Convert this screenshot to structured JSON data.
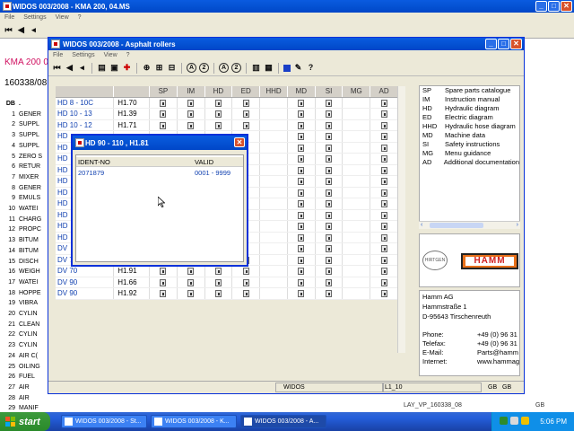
{
  "bg_window": {
    "title": "WIDOS 003/2008 - KMA 200, 04.MS",
    "menu": [
      "File",
      "Settings",
      "View",
      "?"
    ],
    "kma_text": "KMA 200 0",
    "ident_text": "160338/08",
    "table_header": [
      "DB",
      "."
    ],
    "rows": [
      {
        "n": "1",
        "t": "GENER"
      },
      {
        "n": "2",
        "t": "SUPPL"
      },
      {
        "n": "3",
        "t": "SUPPL"
      },
      {
        "n": "4",
        "t": "SUPPL"
      },
      {
        "n": "5",
        "t": "ZERO S"
      },
      {
        "n": "6",
        "t": "RETUR"
      },
      {
        "n": "7",
        "t": "MIXER"
      },
      {
        "n": "8",
        "t": "GENER"
      },
      {
        "n": "9",
        "t": "EMULS"
      },
      {
        "n": "10",
        "t": "WATEI"
      },
      {
        "n": "11",
        "t": "CHARG"
      },
      {
        "n": "12",
        "t": "PROPC"
      },
      {
        "n": "13",
        "t": "BITUM"
      },
      {
        "n": "14",
        "t": "BITUM"
      },
      {
        "n": "15",
        "t": "DISCH"
      },
      {
        "n": "16",
        "t": "WEIGH"
      },
      {
        "n": "17",
        "t": "WATEI"
      },
      {
        "n": "18",
        "t": "HOPPE"
      },
      {
        "n": "19",
        "t": "VIBRA"
      },
      {
        "n": "20",
        "t": "CYLIN"
      },
      {
        "n": "21",
        "t": "CLEAN"
      },
      {
        "n": "22",
        "t": "CYLIN"
      },
      {
        "n": "23",
        "t": "CYLIN"
      },
      {
        "n": "24",
        "t": "AIR C("
      },
      {
        "n": "25",
        "t": "OILING"
      },
      {
        "n": "26",
        "t": "FUEL"
      },
      {
        "n": "27",
        "t": "AIR"
      },
      {
        "n": "28",
        "t": "AIR"
      },
      {
        "n": "29",
        "t": "MANIF"
      }
    ],
    "status_right": "LAY_VP_160338_08",
    "status_gb": "GB"
  },
  "ar_window": {
    "title": "WIDOS 003/2008 - Asphalt rollers",
    "menu": [
      "File",
      "Settings",
      "View",
      "?"
    ],
    "columns": [
      "SP",
      "IM",
      "HD",
      "ED",
      "HHD",
      "MD",
      "SI",
      "MG",
      "AD"
    ],
    "rows": [
      {
        "model": "HD 8 - 10C",
        "ver": "H1.70",
        "marks": [
          1,
          1,
          1,
          1,
          0,
          1,
          1,
          0,
          1
        ]
      },
      {
        "model": "HD 10 - 13",
        "ver": "H1.39",
        "marks": [
          1,
          1,
          1,
          1,
          0,
          1,
          1,
          0,
          1
        ]
      },
      {
        "model": "HD 10 - 12",
        "ver": "H1.71",
        "marks": [
          1,
          1,
          1,
          1,
          0,
          1,
          1,
          0,
          1
        ]
      },
      {
        "model": "HD",
        "ver": "",
        "marks": [
          0,
          0,
          0,
          0,
          0,
          1,
          1,
          0,
          1
        ]
      },
      {
        "model": "HD",
        "ver": "",
        "marks": [
          0,
          0,
          0,
          0,
          0,
          1,
          1,
          0,
          1
        ]
      },
      {
        "model": "HD",
        "ver": "",
        "marks": [
          0,
          0,
          0,
          0,
          0,
          1,
          1,
          0,
          1
        ]
      },
      {
        "model": "HD",
        "ver": "",
        "marks": [
          0,
          0,
          0,
          0,
          0,
          1,
          1,
          0,
          1
        ]
      },
      {
        "model": "HD",
        "ver": "",
        "marks": [
          0,
          0,
          0,
          0,
          0,
          1,
          1,
          0,
          1
        ]
      },
      {
        "model": "HD",
        "ver": "",
        "marks": [
          0,
          0,
          0,
          0,
          0,
          1,
          1,
          0,
          1
        ]
      },
      {
        "model": "HD",
        "ver": "",
        "marks": [
          0,
          0,
          0,
          0,
          0,
          1,
          1,
          0,
          1
        ]
      },
      {
        "model": "HD",
        "ver": "",
        "marks": [
          0,
          0,
          0,
          0,
          0,
          1,
          1,
          0,
          1
        ]
      },
      {
        "model": "HD",
        "ver": "",
        "marks": [
          0,
          0,
          0,
          0,
          0,
          1,
          1,
          0,
          1
        ]
      },
      {
        "model": "HD",
        "ver": "",
        "marks": [
          0,
          0,
          0,
          0,
          0,
          1,
          1,
          0,
          1
        ]
      },
      {
        "model": "DV",
        "ver": "",
        "marks": [
          0,
          0,
          0,
          0,
          0,
          1,
          1,
          0,
          1
        ]
      },
      {
        "model": "DV 70",
        "ver": "H1.65",
        "marks": [
          1,
          1,
          1,
          1,
          0,
          1,
          1,
          0,
          1
        ]
      },
      {
        "model": "DV 70",
        "ver": "H1.91",
        "marks": [
          1,
          1,
          1,
          1,
          0,
          1,
          1,
          0,
          1
        ]
      },
      {
        "model": "DV 90",
        "ver": "H1.66",
        "marks": [
          1,
          1,
          1,
          1,
          0,
          1,
          1,
          0,
          1
        ]
      },
      {
        "model": "DV 90",
        "ver": "H1.92",
        "marks": [
          1,
          1,
          1,
          1,
          0,
          1,
          1,
          0,
          1
        ]
      }
    ],
    "legend": [
      {
        "ab": "SP",
        "label": "Spare parts catalogue"
      },
      {
        "ab": "IM",
        "label": "Instruction manual"
      },
      {
        "ab": "HD",
        "label": "Hydraulic diagram"
      },
      {
        "ab": "ED",
        "label": "Electric diagram"
      },
      {
        "ab": "HHD",
        "label": "Hydraulic hose diagram"
      },
      {
        "ab": "MD",
        "label": "Machine data"
      },
      {
        "ab": "SI",
        "label": "Safety instructions"
      },
      {
        "ab": "MG",
        "label": "Menu guidance"
      },
      {
        "ab": "AD",
        "label": "Additional documentation"
      }
    ],
    "logo_hirtgen": "HIRTGEN",
    "logo_hamm": "HAMM",
    "address": {
      "company": "Hamm AG",
      "street": "Hammstraße 1",
      "city": "D-95643 Tirschenreuth",
      "phone_label": "Phone:",
      "phone": "+49 (0) 96 31",
      "fax_label": "Telefax:",
      "fax": "+49 (0) 96 31",
      "email_label": "E-Mail:",
      "email": "Parts@hamm",
      "web_label": "Internet:",
      "web": "www.hammag"
    },
    "status": {
      "app": "WIDOS",
      "code": "L1_10",
      "lang1": "GB",
      "lang2": "GB"
    }
  },
  "popup": {
    "title": "HD 90 - 110 , H1.81",
    "col_ident": "IDENT-NO",
    "col_valid": "VALID",
    "row_ident": "2071879",
    "row_valid": "0001 - 9999"
  },
  "taskbar": {
    "start": "start",
    "tasks": [
      "WIDOS 003/2008 - St...",
      "WIDOS 003/2008 - K...",
      "WIDOS 003/2008 - A..."
    ],
    "time": "5:06 PM"
  }
}
